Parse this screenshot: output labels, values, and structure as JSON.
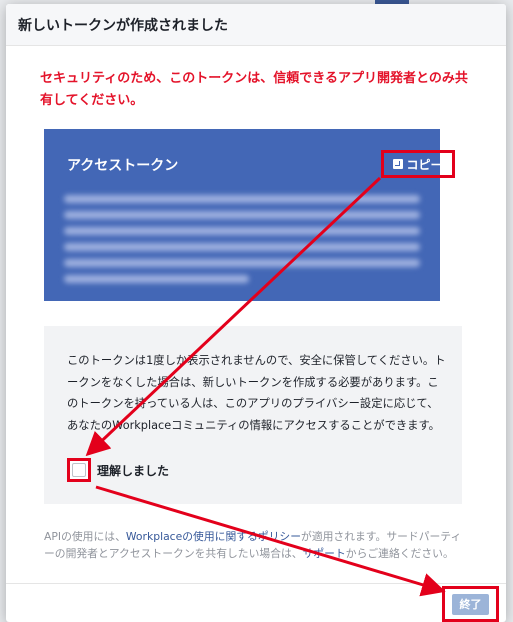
{
  "modal": {
    "title": "新しいトークンが作成されました",
    "warning": "セキュリティのため、このトークンは、信頼できるアプリ開発者とのみ共有してください。"
  },
  "token_panel": {
    "title": "アクセストークン",
    "copy_label": "コピー"
  },
  "notice": {
    "text": "このトークンは1度しか表示されませんので、安全に保管してください。トークンをなくした場合は、新しいトークンを作成する必要があります。このトークンを持っている人は、このアプリのプライバシー設定に応じて、あなたのWorkplaceコミュニティの情報にアクセスすることができます。",
    "checkbox_label": "理解しました"
  },
  "footer": {
    "note_prefix": "APIの使用には、",
    "policy_link": "Workplaceの使用に関するポリシー",
    "note_middle": "が適用されます。サードパーティーの開発者とアクセストークンを共有したい場合は、",
    "support_link": "サポート",
    "note_suffix": "からご連絡ください。",
    "done_label": "終了"
  },
  "colors": {
    "token_panel": "#4367b6",
    "warning": "#e4132a",
    "annotation": "#e3001b",
    "done_button": "#9cb4d8"
  }
}
